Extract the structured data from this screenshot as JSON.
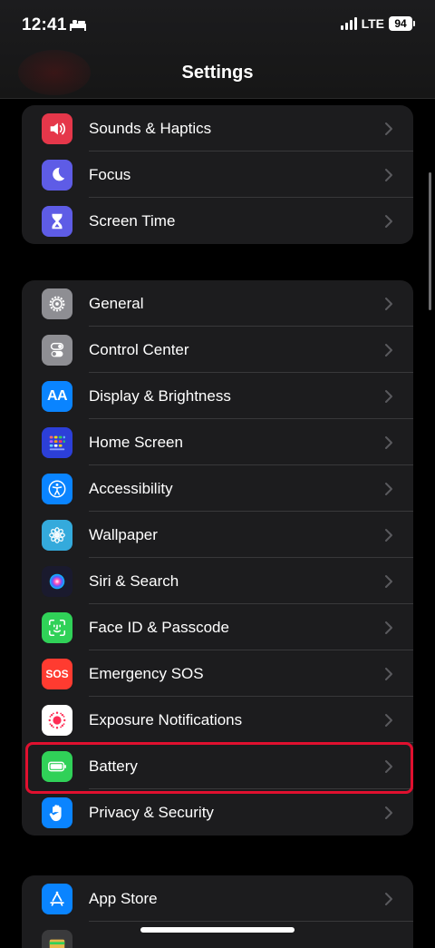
{
  "status_bar": {
    "time": "12:41",
    "network": "LTE",
    "battery": "94"
  },
  "nav": {
    "title": "Settings"
  },
  "groups": [
    {
      "items": [
        {
          "label": "Sounds & Haptics",
          "icon": "speaker-icon",
          "color": "#e5374a"
        },
        {
          "label": "Focus",
          "icon": "moon-icon",
          "color": "#5e5ce6"
        },
        {
          "label": "Screen Time",
          "icon": "hourglass-icon",
          "color": "#5e5ce6"
        }
      ]
    },
    {
      "items": [
        {
          "label": "General",
          "icon": "gear-icon",
          "color": "#8e8e93"
        },
        {
          "label": "Control Center",
          "icon": "toggles-icon",
          "color": "#8e8e93"
        },
        {
          "label": "Display & Brightness",
          "icon": "text-size-icon",
          "color": "#0a84ff",
          "icon_text": "AA"
        },
        {
          "label": "Home Screen",
          "icon": "app-grid-icon",
          "color": "#2c3fd8"
        },
        {
          "label": "Accessibility",
          "icon": "accessibility-icon",
          "color": "#0a84ff"
        },
        {
          "label": "Wallpaper",
          "icon": "flower-icon",
          "color": "#34aadc"
        },
        {
          "label": "Siri & Search",
          "icon": "siri-icon",
          "color": "#1a1a2e"
        },
        {
          "label": "Face ID & Passcode",
          "icon": "face-id-icon",
          "color": "#30d158"
        },
        {
          "label": "Emergency SOS",
          "icon": "sos-icon",
          "color": "#ff3b30",
          "icon_text": "SOS"
        },
        {
          "label": "Exposure Notifications",
          "icon": "exposure-icon",
          "color": "#ffffff"
        },
        {
          "label": "Battery",
          "icon": "battery-icon",
          "color": "#30d158"
        },
        {
          "label": "Privacy & Security",
          "icon": "hand-icon",
          "color": "#0a84ff"
        }
      ]
    },
    {
      "items": [
        {
          "label": "App Store",
          "icon": "app-store-icon",
          "color": "#0a84ff"
        }
      ]
    }
  ]
}
